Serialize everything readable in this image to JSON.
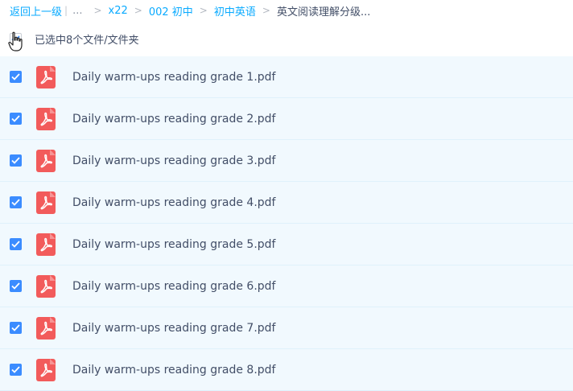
{
  "breadcrumb": {
    "back_label": "返回上一级",
    "separator": "|",
    "ellipsis": "...",
    "arrow": ">",
    "items": [
      "x22",
      "002 初中",
      "初中英语"
    ],
    "current": "英文阅读理解分级..."
  },
  "selection": {
    "count_label": "已选中8个文件/文件夹"
  },
  "files": [
    {
      "name": "Daily warm-ups reading grade 1.pdf"
    },
    {
      "name": "Daily warm-ups reading grade 2.pdf"
    },
    {
      "name": "Daily warm-ups reading grade 3.pdf"
    },
    {
      "name": "Daily warm-ups reading grade 4.pdf"
    },
    {
      "name": "Daily warm-ups reading grade 5.pdf"
    },
    {
      "name": "Daily warm-ups reading grade 6.pdf"
    },
    {
      "name": "Daily warm-ups reading grade 7.pdf"
    },
    {
      "name": "Daily warm-ups reading grade 8.pdf"
    }
  ],
  "colors": {
    "accent": "#09aaff",
    "checkbox": "#3b8cff",
    "pdf_icon": "#f25b5b",
    "row_bg": "#f1f9fe"
  }
}
